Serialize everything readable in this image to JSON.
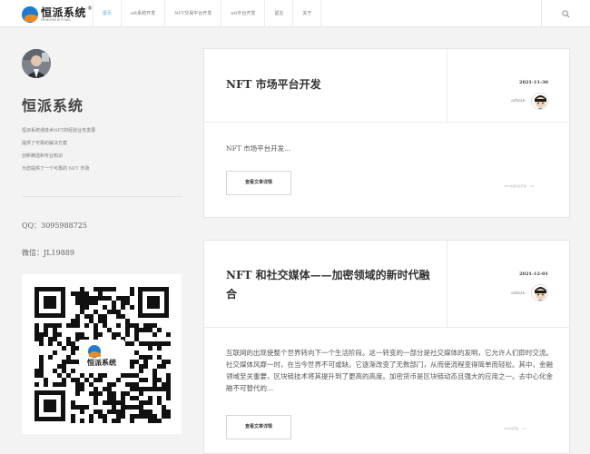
{
  "header": {
    "logo_cn": "恒派系统",
    "logo_en": "HENGPAIXITONG",
    "logo_reg": "®",
    "nav": [
      {
        "label": "首页",
        "active": true
      },
      {
        "label": "nft系统开发",
        "active": false
      },
      {
        "label": "NFT交易平台开发",
        "active": false
      },
      {
        "label": "nft平台开发",
        "active": false
      },
      {
        "label": "留言",
        "active": false
      },
      {
        "label": "关于",
        "active": false
      }
    ],
    "search_icon": "search-icon"
  },
  "sidebar": {
    "site_title": "恒派系统",
    "motto": [
      "恒派系统通技术NFT的经验业务发展",
      "提供了可靠的解决方案",
      "创新精选和专业知识",
      "为您提供了一个可靠的 NFT 市场"
    ],
    "qq": "QQ：3095988725",
    "wechat": "微信：JL19889",
    "qr_logo_cn": "恒派系统",
    "qr_logo_en": "HENGPAIXITONG"
  },
  "posts": [
    {
      "title": "NFT 市场平台开发",
      "date": "2021-11-30",
      "author": "admin",
      "excerpt": "NFT 市场平台开发...",
      "button": "查看文章详情",
      "meta": "NFT交易平台开发 · · 34"
    },
    {
      "title": "NFT 和社交媒体——加密领域的新时代融合",
      "date": "2021-12-01",
      "author": "admin",
      "excerpt": "互联网的出现使整个世界转向下一个生活阶段。这一转变的一部分是社交媒体的发明，它允许人们即时交流。社交媒体风靡一时，在当今世界不可或缺。它逐渐改变了无数部门，从而使流程变得简单而轻松。其中，金融领域至关重要，区块链技术将其提升到了更高的高度。加密货币是区块链动态且强大的应用之一。去中心化金融不可替代的...",
      "button": "查看文章详情",
      "meta": "nft平台开发 · · 17"
    }
  ],
  "colors": {
    "accent": "#5aaee0",
    "background": "#f3f3f3"
  }
}
